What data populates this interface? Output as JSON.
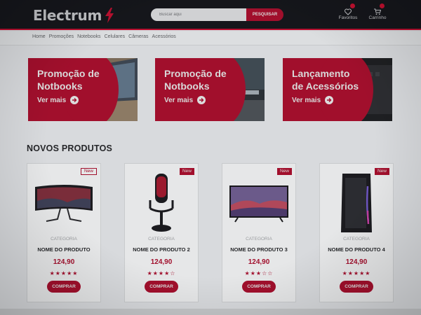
{
  "header": {
    "logo": "Electrum",
    "search_placeholder": "Buscar aqui",
    "search_button": "PESQUISAR",
    "favorites_label": "Favoritos",
    "cart_label": "Carrinho"
  },
  "nav": {
    "items": [
      "Home",
      "Promoções",
      "Notebooks",
      "Celulares",
      "Câmeras",
      "Acessórios"
    ]
  },
  "banners": [
    {
      "line1": "Promoção de",
      "line2": "Notbooks",
      "link": "Ver mais"
    },
    {
      "line1": "Promoção de",
      "line2": "Notbooks",
      "link": "Ver mais"
    },
    {
      "line1": "Lançamento",
      "line2": "de Acessórios",
      "link": "Ver mais"
    }
  ],
  "section_title": "NOVOS PRODUTOS",
  "products": [
    {
      "badge": "New",
      "category": "CATEGORIA",
      "name": "NOME DO PRODUTO",
      "price": "124,90",
      "rating": 5,
      "stars": "★★★★★",
      "button": "COMPRAR",
      "image_icon": "curved-monitor-icon"
    },
    {
      "badge": "New",
      "category": "CATEGORIA",
      "name": "NOME DO PRODUTO 2",
      "price": "124,90",
      "rating": 4,
      "stars": "★★★★☆",
      "button": "COMPRAR",
      "image_icon": "microphone-icon"
    },
    {
      "badge": "New",
      "category": "CATEGORIA",
      "name": "NOME DO PRODUTO 3",
      "price": "124,90",
      "rating": 3,
      "stars": "★★★☆☆",
      "button": "COMPRAR",
      "image_icon": "tv-icon"
    },
    {
      "badge": "New",
      "category": "CATEGORIA",
      "name": "NOME DO PRODUTO 4",
      "price": "124,90",
      "rating": 5,
      "stars": "★★★★★",
      "button": "COMPRAR",
      "image_icon": "pc-tower-icon"
    }
  ],
  "colors": {
    "accent": "#a10f2c",
    "header_bg": "#15161b",
    "page_bg": "#d8dadd"
  }
}
